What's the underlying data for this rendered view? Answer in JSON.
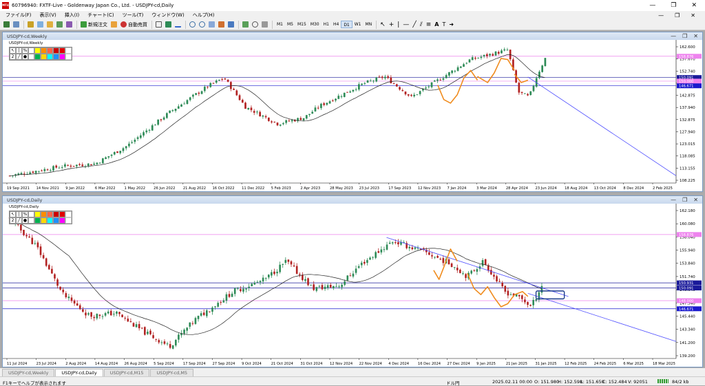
{
  "window": {
    "title": "60796940: FXTF-Live - Goldenway Japan Co., Ltd. - USDJPY-cd,Daily",
    "app_icon": "MT4",
    "minimize": "—",
    "maximize": "❐",
    "close": "✕"
  },
  "menu": {
    "items": [
      "ファイル(F)",
      "表示(V)",
      "挿入(I)",
      "チャート(C)",
      "ツール(T)",
      "ウィンドウ(W)",
      "ヘルプ(H)"
    ],
    "right_controls": [
      "—",
      "❐",
      "✕"
    ]
  },
  "toolbar": {
    "new_order": "新規注文",
    "auto_trade": "自動売買",
    "timeframes": [
      "M1",
      "M5",
      "M15",
      "M30",
      "H1",
      "H4",
      "D1",
      "W1",
      "MN"
    ],
    "active_timeframe": "D1"
  },
  "weekly_chart": {
    "caption": "USDJPY-cd,Weekly",
    "inner_label": "USDJPY-cd,Weekly",
    "controls": [
      "—",
      "❐",
      "✕"
    ],
    "price_labels": [
      "162.600",
      "157.670",
      "152.740",
      "147.805",
      "142.875",
      "137.940",
      "132.875",
      "127.940",
      "123.015",
      "118.085",
      "113.155",
      "108.225"
    ],
    "highlight_labels": {
      "pink_top": "158.876",
      "blue_a": "150.091",
      "pink_mid": "150.000",
      "blue_b": "146.671",
      "current": "150.091"
    },
    "date_labels": [
      "19 Sep 2021",
      "14 Nov 2021",
      "9 Jan 2022",
      "6 Mar 2022",
      "1 May 2022",
      "26 Jun 2022",
      "21 Aug 2022",
      "16 Oct 2022",
      "11 Dec 2022",
      "5 Feb 2023",
      "2 Apr 2023",
      "28 May 2023",
      "23 Jul 2023",
      "17 Sep 2023",
      "12 Nov 2023",
      "7 Jan 2024",
      "3 Mar 2024",
      "28 Apr 2024",
      "23 Jun 2024",
      "18 Aug 2024",
      "13 Oct 2024",
      "8 Dec 2024",
      "2 Feb 2025"
    ],
    "palette_row_label": "2"
  },
  "daily_chart": {
    "caption": "USDJPY-cd,Daily",
    "inner_label": "USDJPY-cd,Daily",
    "controls": [
      "—",
      "❐",
      "✕"
    ],
    "price_labels": [
      "162.180",
      "160.080",
      "158.040",
      "155.940",
      "153.840",
      "151.740",
      "149.640",
      "147.540",
      "145.440",
      "143.340",
      "141.200",
      "139.200"
    ],
    "highlight_labels": {
      "pink_top": "158.876",
      "current": "150.931",
      "blue_a": "150.091",
      "pink_mid": "148.000",
      "blue_b": "146.671"
    },
    "date_labels": [
      "11 Jul 2024",
      "23 Jul 2024",
      "2 Aug 2024",
      "14 Aug 2024",
      "26 Aug 2024",
      "5 Sep 2024",
      "17 Sep 2024",
      "27 Sep 2024",
      "9 Oct 2024",
      "21 Oct 2024",
      "31 Oct 2024",
      "12 Nov 2024",
      "22 Nov 2024",
      "4 Dec 2024",
      "16 Dec 2024",
      "27 Dec 2024",
      "9 Jan 2025",
      "21 Jan 2025",
      "31 Jan 2025",
      "12 Feb 2025",
      "24 Feb 2025",
      "6 Mar 2025",
      "18 Mar 2025"
    ],
    "palette_row_label": "2"
  },
  "tabs": [
    "USDJPY-cd,Weekly",
    "USDJPY-cd,Daily",
    "USDJPY-cd,M15",
    "USDJPY-cd,M5"
  ],
  "active_tab": "USDJPY-cd,Daily",
  "status": {
    "help": "F1キーでヘルプが表示されます",
    "layout": "ドル円",
    "datetime": "2025.02.11 00:00",
    "open": "O: 151.980",
    "high": "H: 152.598",
    "low": "L: 151.650",
    "close": "C: 152.484",
    "volume": "V: 92051",
    "traffic": "84/2 kb"
  },
  "colors": {
    "bull": "#2e8b57",
    "bear": "#b22222",
    "ma": "#222222",
    "hline_pink": "#ee82ee",
    "hline_blue": "#1a1acd",
    "trendline": "#4b4bff",
    "annotation": "#f08c1e"
  }
}
